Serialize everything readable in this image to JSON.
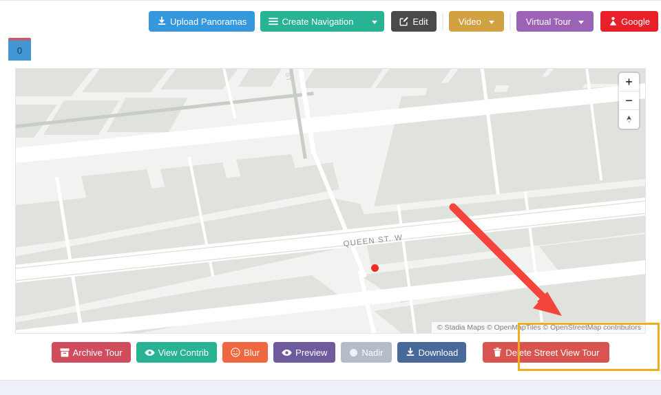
{
  "toolbar": {
    "upload_label": "Upload Panoramas",
    "upload_icon": "download-tray-icon",
    "create_nav_label": "Create Navigation",
    "create_nav_icon": "hamburger-icon",
    "edit_label": "Edit",
    "edit_icon": "pencil-square-icon",
    "video_label": "Video",
    "virtual_tour_label": "Virtual Tour",
    "google_label": "Google",
    "google_icon": "google-streetview-icon"
  },
  "pano_tab": {
    "label": "0"
  },
  "map": {
    "street_label_main": "QUEEN ST. W",
    "street_label_vertical": "ST",
    "attribution": "© Stadia Maps © OpenMapTiles © OpenStreetMap contributors",
    "zoom_in_label": "+",
    "zoom_out_label": "−",
    "compass_label": "compass",
    "marker_color": "#ef2b24",
    "land_color": "#dfe2dd",
    "background_color": "#f2f3f0",
    "road_color": "#ffffff"
  },
  "annotation": {
    "arrow_color": "#f4453c",
    "highlight_color": "#f0ad1e"
  },
  "actions": {
    "archive_label": "Archive Tour",
    "archive_icon": "archive-box-icon",
    "contrib_label": "View Contrib",
    "contrib_icon": "eye-icon",
    "blur_label": "Blur",
    "blur_icon": "smiley-face-icon",
    "preview_label": "Preview",
    "preview_icon": "eye-icon",
    "nadir_label": "Nadir",
    "nadir_icon": "circle-icon",
    "download_label": "Download",
    "download_icon": "download-tray-icon",
    "delete_label": "Delete Street View Tour",
    "delete_icon": "trash-can-icon"
  }
}
